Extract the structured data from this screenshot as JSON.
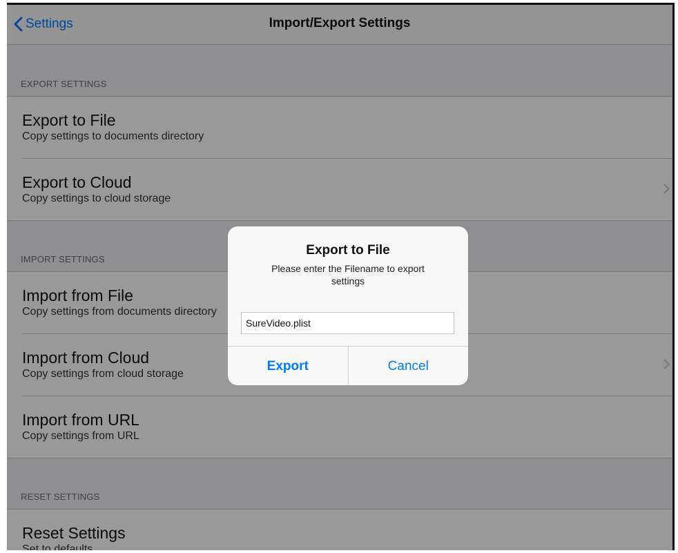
{
  "navbar": {
    "back_label": "Settings",
    "title": "Import/Export Settings"
  },
  "sections": {
    "export": {
      "header": "EXPORT SETTINGS",
      "items": [
        {
          "title": "Export to File",
          "subtitle": "Copy settings to documents directory"
        },
        {
          "title": "Export to Cloud",
          "subtitle": "Copy settings to cloud storage"
        }
      ]
    },
    "import": {
      "header": "IMPORT SETTINGS",
      "items": [
        {
          "title": "Import from File",
          "subtitle": "Copy settings from documents directory"
        },
        {
          "title": "Import from Cloud",
          "subtitle": "Copy settings from cloud storage"
        },
        {
          "title": "Import from URL",
          "subtitle": "Copy settings from URL"
        }
      ]
    },
    "reset": {
      "header": "RESET SETTINGS",
      "items": [
        {
          "title": "Reset Settings",
          "subtitle": "Set to defaults"
        }
      ]
    }
  },
  "alert": {
    "title": "Export to File",
    "message": "Please enter the Filename to export settings",
    "input_value": "SureVideo.plist",
    "primary_label": "Export",
    "cancel_label": "Cancel"
  },
  "icons": {
    "back": "chevron-left-icon",
    "disclosure": "chevron-right-icon"
  },
  "colors": {
    "accent": "#007aff",
    "background": "#efeff4",
    "separator": "#c8c7cc",
    "overlay": "rgba(0,0,0,0.40)"
  }
}
